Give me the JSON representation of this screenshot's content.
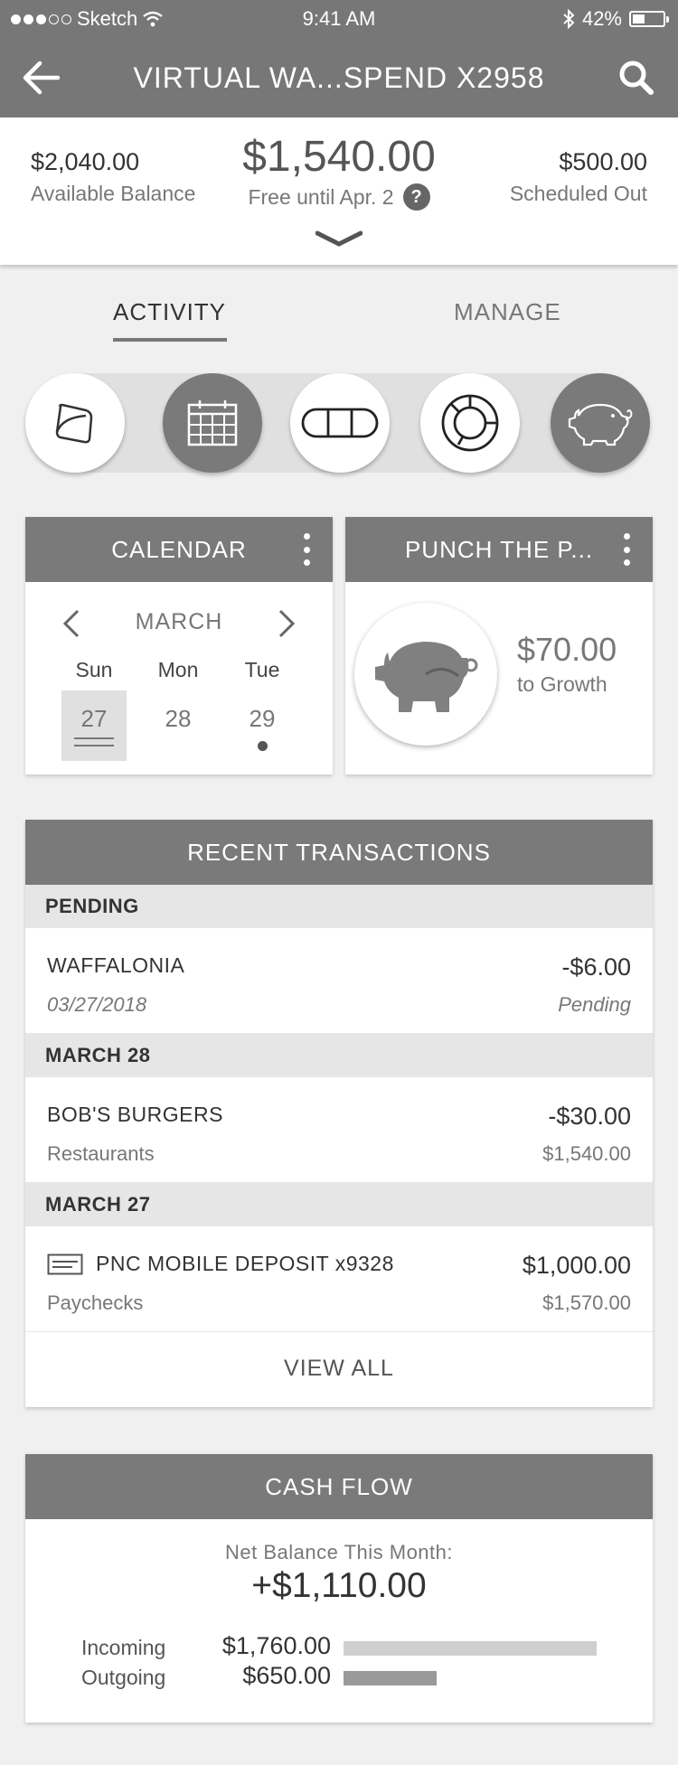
{
  "status_bar": {
    "carrier": "Sketch",
    "time": "9:41 AM",
    "battery_text": "42%",
    "battery_level": 0.42,
    "signal_bars_filled": 3,
    "signal_bars_total": 5
  },
  "nav": {
    "title": "VIRTUAL WA...SPEND X2958",
    "back_icon": "arrow-left-icon",
    "search_icon": "search-icon"
  },
  "summary": {
    "available_amount": "$2,040.00",
    "available_label": "Available Balance",
    "free_amount": "$1,540.00",
    "free_label": "Free until Apr. 2",
    "help_glyph": "?",
    "scheduled_amount": "$500.00",
    "scheduled_label": "Scheduled Out"
  },
  "tabs": {
    "activity": "ACTIVITY",
    "manage": "MANAGE"
  },
  "widgets": [
    {
      "icon": "wallet-icon",
      "style": "light"
    },
    {
      "icon": "calendar-icon",
      "style": "dark"
    },
    {
      "icon": "pill-icon",
      "style": "light"
    },
    {
      "icon": "donut-chart-icon",
      "style": "light"
    },
    {
      "icon": "piggy-bank-icon",
      "style": "dark"
    }
  ],
  "calendar": {
    "title": "CALENDAR",
    "month": "MARCH",
    "days": [
      {
        "name": "Sun",
        "date": "27",
        "today": true,
        "event": false
      },
      {
        "name": "Mon",
        "date": "28",
        "today": false,
        "event": false
      },
      {
        "name": "Tue",
        "date": "29",
        "today": false,
        "event": true
      }
    ]
  },
  "punch": {
    "title": "PUNCH THE P...",
    "amount": "$70.00",
    "label": "to Growth"
  },
  "transactions": {
    "title": "RECENT TRANSACTIONS",
    "sections": [
      {
        "header": "PENDING",
        "items": [
          {
            "name": "WAFFALONIA",
            "sub": "03/27/2018",
            "amount": "-$6.00",
            "sub_right": "Pending",
            "italic": true
          }
        ]
      },
      {
        "header": "MARCH 28",
        "items": [
          {
            "name": "BOB'S BURGERS",
            "sub": "Restaurants",
            "amount": "-$30.00",
            "sub_right": "$1,540.00",
            "italic": false
          }
        ]
      },
      {
        "header": "MARCH 27",
        "items": [
          {
            "name": "PNC MOBILE DEPOSIT x9328",
            "sub": "Paychecks",
            "amount": "$1,000.00",
            "sub_right": "$1,570.00",
            "italic": false,
            "icon": "check-deposit-icon"
          }
        ]
      }
    ],
    "view_all": "VIEW ALL"
  },
  "cash_flow": {
    "title": "CASH FLOW",
    "net_label": "Net Balance This Month:",
    "net_amount": "+$1,110.00",
    "incoming_label": "Incoming",
    "incoming_amount": "$1,760.00",
    "incoming_value": 1760,
    "outgoing_label": "Outgoing",
    "outgoing_amount": "$650.00",
    "outgoing_value": 650,
    "bar_colors": {
      "incoming": "#cfcfcf",
      "outgoing": "#9a9a9a"
    }
  }
}
